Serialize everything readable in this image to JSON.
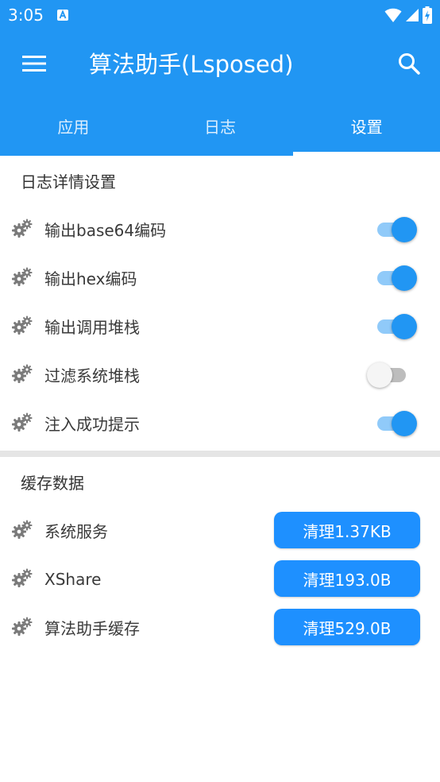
{
  "status_bar": {
    "time": "3:05"
  },
  "toolbar": {
    "title": "算法助手(Lsposed)"
  },
  "tabs": [
    {
      "label": "应用",
      "active": false
    },
    {
      "label": "日志",
      "active": false
    },
    {
      "label": "设置",
      "active": true
    }
  ],
  "log_settings": {
    "header": "日志详情设置",
    "items": [
      {
        "label": "输出base64编码",
        "enabled": true
      },
      {
        "label": "输出hex编码",
        "enabled": true
      },
      {
        "label": "输出调用堆栈",
        "enabled": true
      },
      {
        "label": "过滤系统堆栈",
        "enabled": false
      },
      {
        "label": "注入成功提示",
        "enabled": true
      }
    ]
  },
  "cache_data": {
    "header": "缓存数据",
    "items": [
      {
        "label": "系统服务",
        "button": "清理1.37KB"
      },
      {
        "label": "XShare",
        "button": "清理193.0B"
      },
      {
        "label": "算法助手缓存",
        "button": "清理529.0B"
      }
    ]
  },
  "colors": {
    "primary": "#2196F3",
    "switch_on_track": "#90CAF9",
    "switch_off_track": "#BDBDBD",
    "button": "#1E90FF"
  },
  "icons": {
    "menu": "menu-icon",
    "search": "search-icon",
    "setting_row": "gears-icon",
    "status_notification": "notification-a-icon",
    "status_wifi": "wifi-icon",
    "status_signal": "signal-icon",
    "status_battery": "battery-charging-icon"
  }
}
